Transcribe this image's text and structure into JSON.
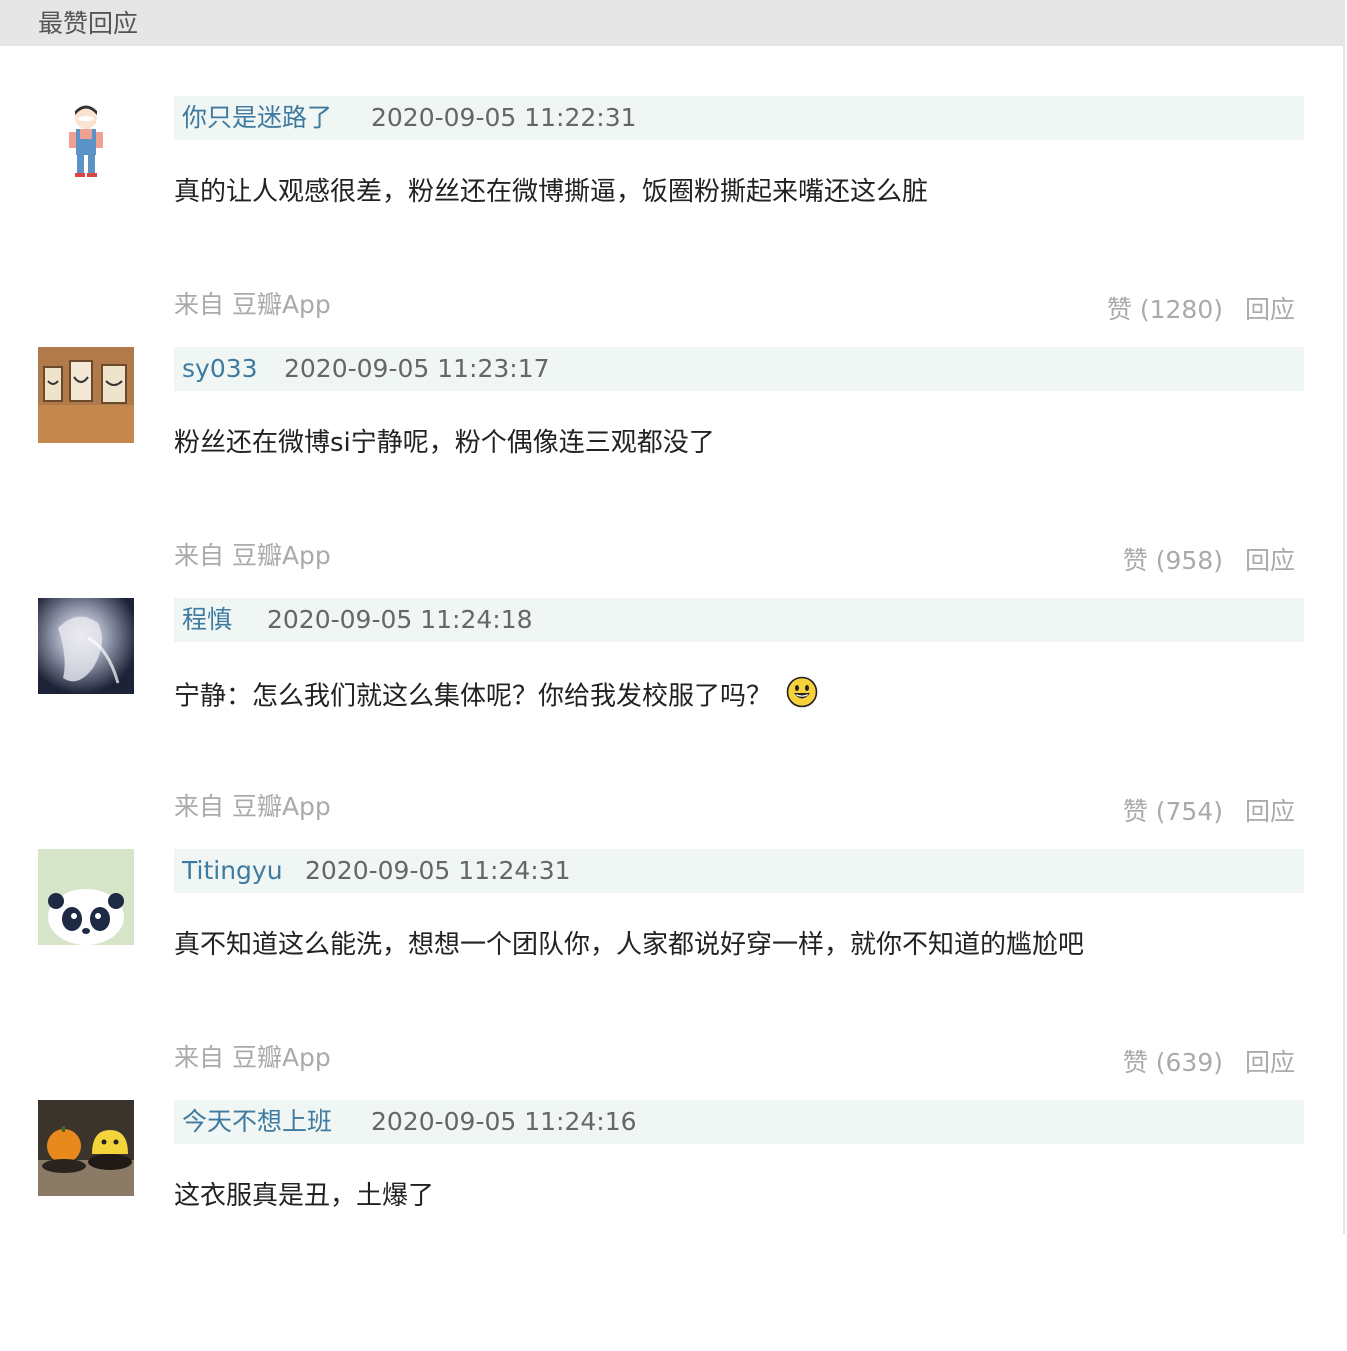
{
  "section": {
    "title": "最赞回应"
  },
  "comments": [
    {
      "username": "你只是迷路了",
      "timestamp": "2020-09-05 11:22:31",
      "text": "真的让人观感很差，粉丝还在微博撕逼，饭圈粉撕起来嘴还这么脏",
      "source": "来自 豆瓣App",
      "likes": "赞 (1280)",
      "reply": "回应"
    },
    {
      "username": "sy033",
      "timestamp": "2020-09-05 11:23:17",
      "text": "粉丝还在微博si宁静呢，粉个偶像连三观都没了",
      "source": "来自 豆瓣App",
      "likes": "赞 (958)",
      "reply": "回应"
    },
    {
      "username": "程慎",
      "timestamp": "2020-09-05 11:24:18",
      "text": "宁静：怎么我们就这么集体呢？你给我发校服了吗？",
      "source": "来自 豆瓣App",
      "likes": "赞 (754)",
      "reply": "回应"
    },
    {
      "username": "Titingyu",
      "timestamp": "2020-09-05 11:24:31",
      "text": "真不知道这么能洗，想想一个团队你，人家都说好穿一样，就你不知道的尴尬吧",
      "source": "来自 豆瓣App",
      "likes": "赞 (639)",
      "reply": "回应"
    },
    {
      "username": "今天不想上班",
      "timestamp": "2020-09-05 11:24:16",
      "text": "这衣服真是丑，土爆了"
    }
  ],
  "icons": {
    "emoji": "grinning-face-icon"
  }
}
